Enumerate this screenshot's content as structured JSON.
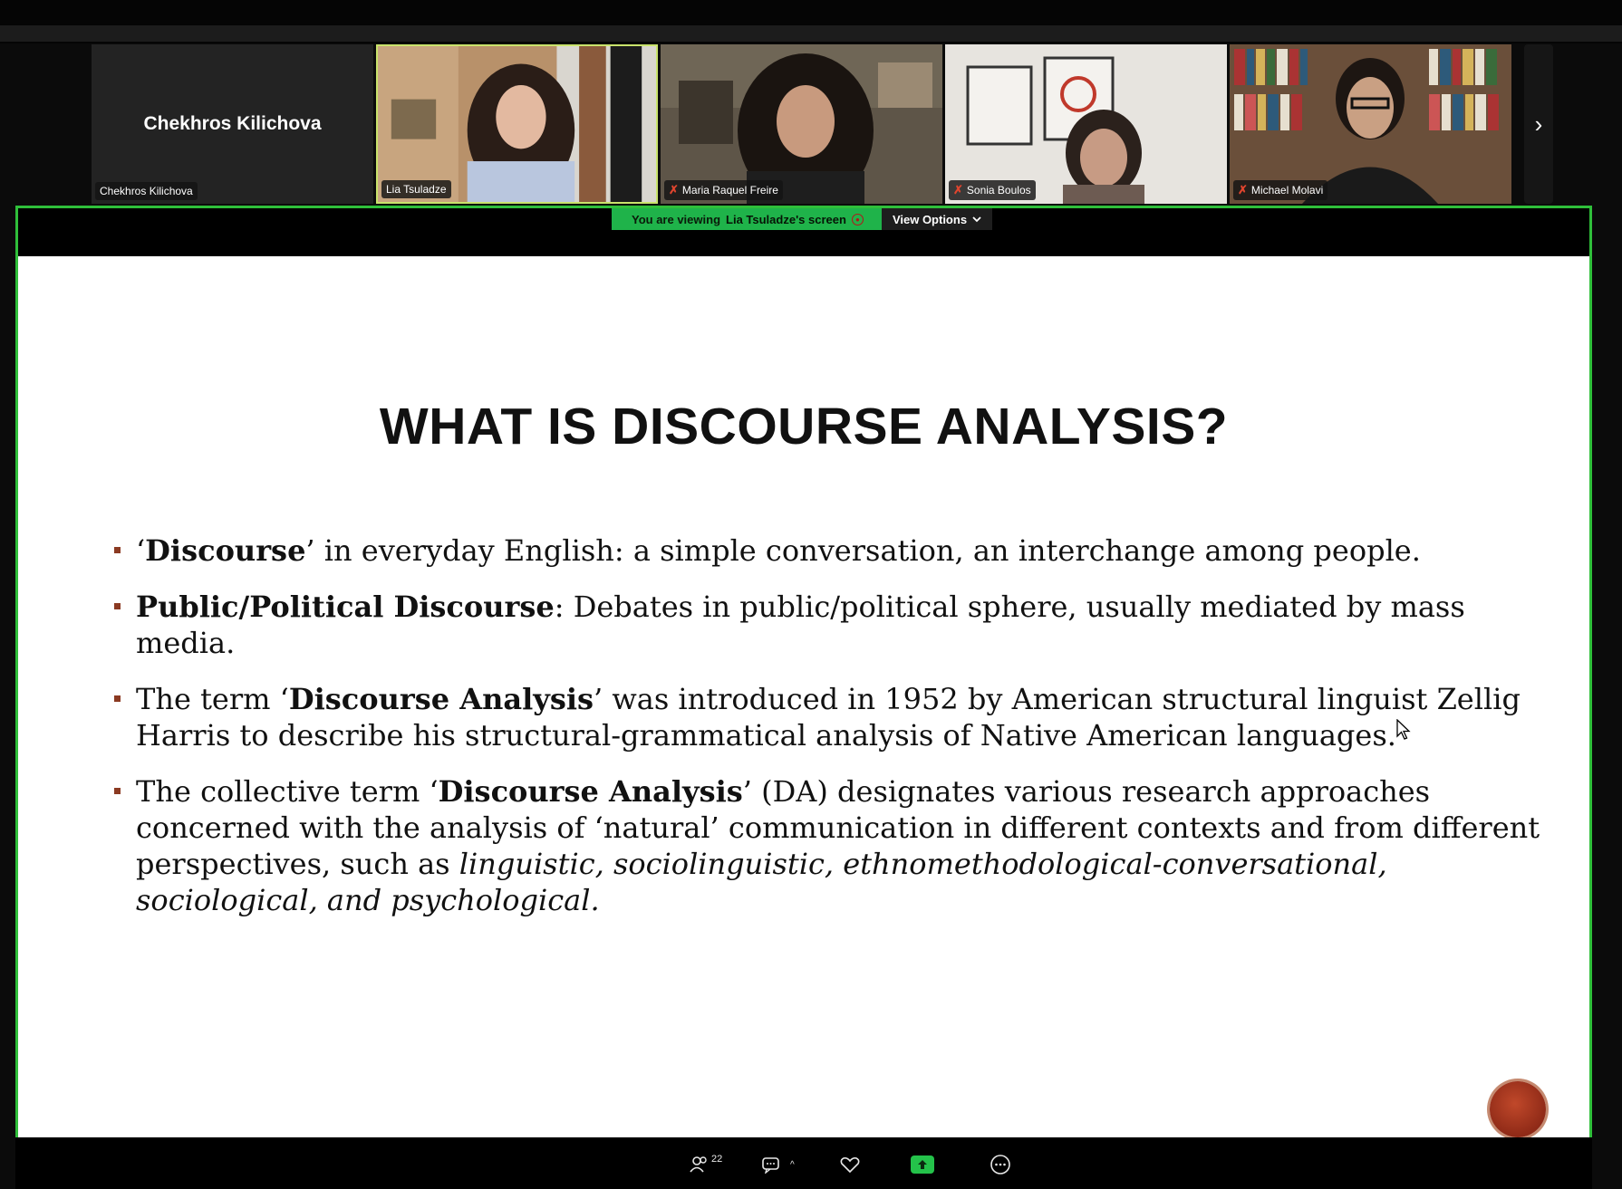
{
  "gallery": {
    "tiles": [
      {
        "name": "Chekhros Kilichova",
        "display_name": "Chekhros Kilichova",
        "muted": false
      },
      {
        "name": "Lia Tsuladze",
        "muted": false
      },
      {
        "name": "Maria Raquel Freire",
        "muted": true
      },
      {
        "name": "Sonia Boulos",
        "muted": true
      },
      {
        "name": "Michael Molavi",
        "muted": true
      }
    ],
    "next_icon": "chevron-right-icon"
  },
  "share_banner": {
    "viewing_prefix": "You are viewing",
    "viewing_name": "Lia Tsuladze's screen",
    "view_options": "View Options"
  },
  "slide": {
    "title": "WHAT IS DISCOURSE ANALYSIS?",
    "bullets": [
      {
        "parts": [
          {
            "t": "‘"
          },
          {
            "t": "Discourse",
            "b": true
          },
          {
            "t": "’ in everyday English: a simple conversation, an interchange among people."
          }
        ]
      },
      {
        "parts": [
          {
            "t": "Public/Political Discourse",
            "b": true
          },
          {
            "t": ": Debates in public/political sphere, usually mediated by mass media."
          }
        ]
      },
      {
        "parts": [
          {
            "t": "The term ‘"
          },
          {
            "t": "Discourse Analysis",
            "b": true
          },
          {
            "t": "’ was introduced in 1952 by American structural linguist Zellig Harris to describe his structural-grammatical analysis of Native American languages."
          }
        ]
      },
      {
        "parts": [
          {
            "t": "The collective term ‘"
          },
          {
            "t": "Discourse Analysis",
            "b": true
          },
          {
            "t": "’ (DA) designates various research approaches concerned with the analysis of ‘natural’ communication in different contexts and from different perspectives, such as "
          },
          {
            "t": "linguistic, sociolinguistic, ethnomethodological-conversational, sociological, and psychological.",
            "i": true
          }
        ]
      }
    ]
  },
  "toolbar": {
    "participants_count": "22",
    "icons": [
      "participants-icon",
      "chat-icon",
      "reactions-icon",
      "share-screen-icon",
      "more-icon"
    ]
  },
  "colors": {
    "share_border": "#2fbf3a",
    "viewing_banner": "#1fb34a",
    "bullet": "#8b3a22",
    "mic_off": "#e0452e"
  }
}
